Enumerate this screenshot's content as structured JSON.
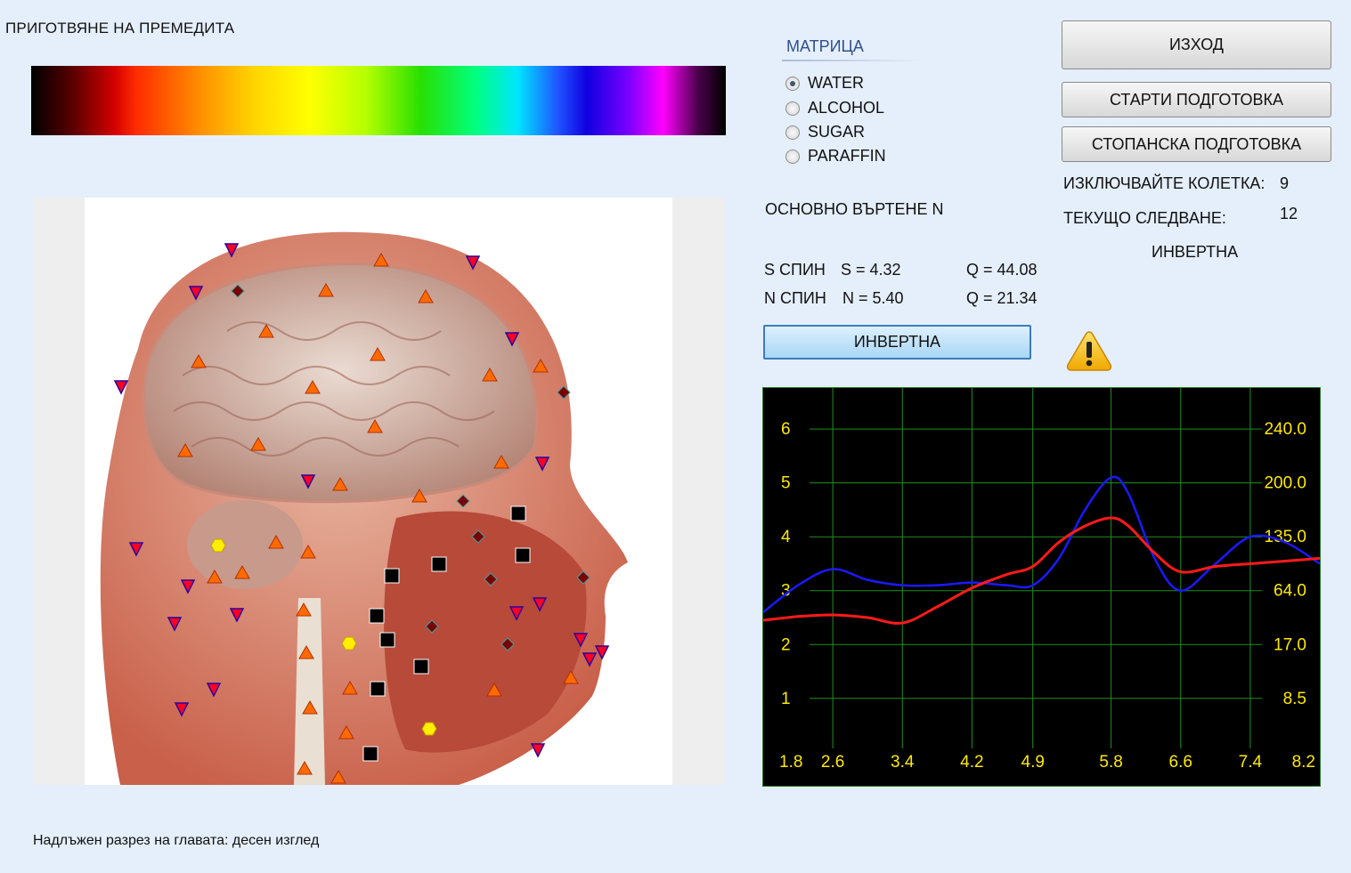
{
  "window": {
    "title": "ПРИГОТВЯНЕ НА ПРЕМЕДИТА"
  },
  "caption": "Надлъжен разрез на главата: десен изглед",
  "matrix": {
    "title": "МАТРИЦА",
    "options": [
      {
        "label": "WATER",
        "checked": true
      },
      {
        "label": "ALCOHOL",
        "checked": false
      },
      {
        "label": "SUGAR",
        "checked": false
      },
      {
        "label": "PARAFFIN",
        "checked": false
      }
    ]
  },
  "rotation_label": "ОСНОВНО ВЪРТЕНЕ N",
  "spin": {
    "s": {
      "label": "S СПИН",
      "value": "S = 4.32",
      "q": "Q = 44.08"
    },
    "n": {
      "label": "N СПИН",
      "value": "N = 5.40",
      "q": "Q = 21.34"
    }
  },
  "invert_button": "ИНВЕРТНА",
  "buttons": {
    "exit": "ИЗХОД",
    "start_prep": "СТАРТИ ПОДГОТОВКА",
    "economic_prep": "СТОПАНСКА ПОДГОТОВКА"
  },
  "status": {
    "exclude_label": "ИЗКЛЮЧВАЙТЕ КОЛЕТКА:",
    "exclude_value": "9",
    "current_label": "ТЕКУЩО СЛЕДВАНЕ:",
    "current_value": "12",
    "mode_text": "ИНВЕРТНА"
  },
  "icons": {
    "warning": "warning-icon"
  },
  "colors": {
    "background": "#e5effb",
    "chart_bg": "#000000",
    "grid": "#1f8f1f",
    "tick_text": "#ffe900",
    "series_red": "#ff1a1a",
    "series_blue": "#1a1aff"
  },
  "chart_data": {
    "type": "line",
    "xlim": [
      1.8,
      8.2
    ],
    "x_ticks": [
      "1.8",
      "2.6",
      "3.4",
      "4.2",
      "4.9",
      "5.8",
      "6.6",
      "7.4",
      "8.2"
    ],
    "ylim": [
      0.6,
      6.3
    ],
    "y_ticks_left": [
      "6",
      "5",
      "4",
      "3",
      "2",
      "1"
    ],
    "y_ticks_right": [
      "240.0",
      "200.0",
      "135.0",
      "64.0",
      "17.0",
      "8.5"
    ],
    "grid": true,
    "series": [
      {
        "color": "#1a1aff",
        "x": [
          1.8,
          2.2,
          2.6,
          3.0,
          3.4,
          3.8,
          4.2,
          4.6,
          4.9,
          5.2,
          5.5,
          5.8,
          6.0,
          6.3,
          6.6,
          7.0,
          7.4,
          7.8,
          8.2
        ],
        "y": [
          2.6,
          3.1,
          3.4,
          3.2,
          3.1,
          3.1,
          3.15,
          3.1,
          3.1,
          3.6,
          4.5,
          5.1,
          4.8,
          3.6,
          3.0,
          3.5,
          4.0,
          3.9,
          3.5
        ]
      },
      {
        "color": "#ff1a1a",
        "x": [
          1.8,
          2.2,
          2.6,
          3.0,
          3.4,
          3.8,
          4.2,
          4.6,
          4.9,
          5.2,
          5.5,
          5.8,
          6.0,
          6.3,
          6.6,
          7.0,
          7.4,
          7.8,
          8.2
        ],
        "y": [
          2.45,
          2.52,
          2.55,
          2.5,
          2.4,
          2.7,
          3.05,
          3.3,
          3.45,
          3.9,
          4.2,
          4.35,
          4.2,
          3.7,
          3.35,
          3.45,
          3.5,
          3.55,
          3.6
        ]
      }
    ]
  }
}
